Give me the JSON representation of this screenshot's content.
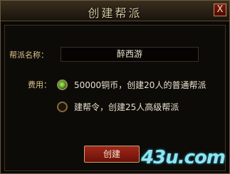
{
  "dialog": {
    "title": "创建帮派",
    "close_label": "X"
  },
  "form": {
    "name_label": "帮派名称：",
    "name_value": "醉西游",
    "fee_label": "费用：",
    "options": [
      {
        "label": "50000铜币，创建20人的普通帮派",
        "selected": true
      },
      {
        "label": "建帮令，创建25人高级帮派",
        "selected": false
      }
    ],
    "create_label": "创建"
  },
  "watermark": "43u.com"
}
